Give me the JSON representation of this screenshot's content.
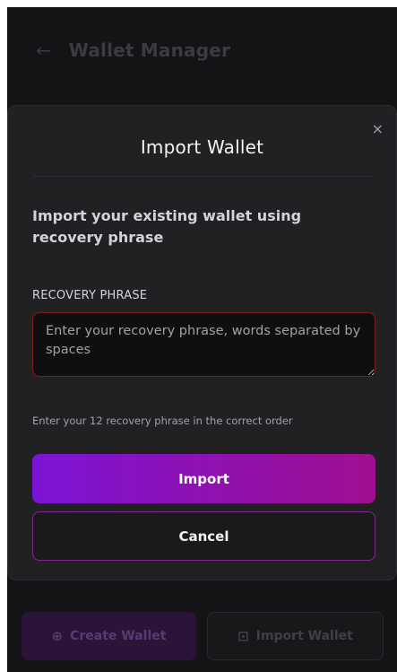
{
  "background": {
    "back_icon": "←",
    "title": "Wallet Manager",
    "create_icon": "⊕",
    "create_label": "Create Wallet",
    "import_icon": "⊡",
    "import_label": "Import Wallet"
  },
  "modal": {
    "close_icon": "×",
    "title": "Import Wallet",
    "subtitle": "Import your existing wallet using recovery phrase",
    "field_label": "RECOVERY PHRASE",
    "field_value": "",
    "field_placeholder": "Enter your recovery phrase, words separated by spaces",
    "hint": "Enter your 12 recovery phrase in the correct order",
    "import_button": "Import",
    "cancel_button": "Cancel"
  },
  "colors": {
    "accent_start": "#7c14d6",
    "accent_end": "#a00f8f",
    "error_border": "#7f1d1d",
    "modal_bg": "#212124",
    "page_bg": "#141416"
  }
}
